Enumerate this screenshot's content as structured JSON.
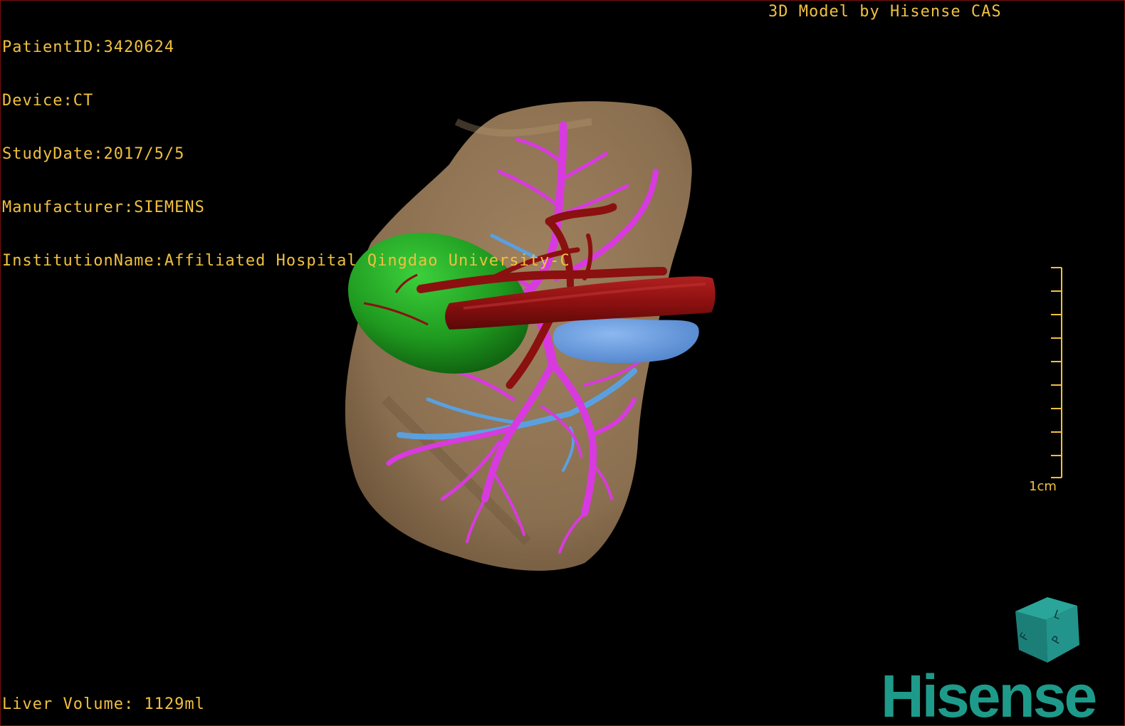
{
  "overlay": {
    "patient_id": "PatientID:3420624",
    "device": "Device:CT",
    "study_date": "StudyDate:2017/5/5",
    "manufacturer": "Manufacturer:SIEMENS",
    "institution": "InstitutionName:Affiliated Hospital Qingdao University-C",
    "watermark": "3D Model by Hisense CAS",
    "liver_volume": "Liver Volume: 1129ml"
  },
  "scale_bar": {
    "label": "1cm"
  },
  "orientation_cube": {
    "labels": [
      "F",
      "L",
      "P"
    ]
  },
  "brand": {
    "logo_text": "Hisense"
  },
  "model": {
    "structures": [
      "liver",
      "gallbladder",
      "hepatic-artery",
      "portal-vein",
      "hepatic-vein",
      "inferior-vena-cava",
      "kidney"
    ],
    "colors": {
      "hud_text": "#f0c040",
      "liver": "#8a6f50",
      "gallbladder": "#1f9a1f",
      "artery": "#8b1010",
      "portal_vein": "#d83ae0",
      "hepatic_vein": "#5aa0e0",
      "kidney": "#6a9ee0",
      "brand": "#1e9a8a"
    }
  }
}
